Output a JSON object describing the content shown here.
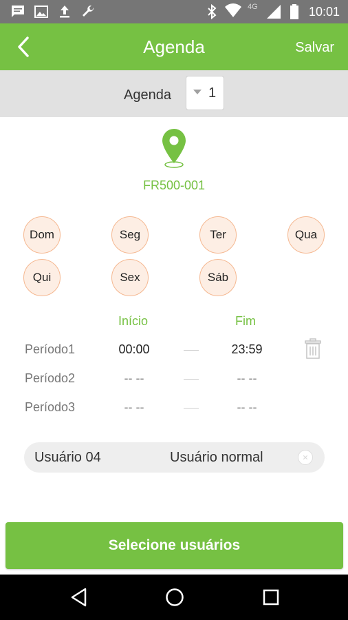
{
  "status_bar": {
    "time": "10:01",
    "network": "4G",
    "icons": [
      "message-icon",
      "image-icon",
      "upload-icon",
      "wrench-icon",
      "bluetooth-icon",
      "wifi-icon",
      "signal-icon",
      "battery-icon"
    ]
  },
  "app_bar": {
    "title": "Agenda",
    "save_label": "Salvar",
    "back_icon": "chevron-left-icon"
  },
  "agenda": {
    "label": "Agenda",
    "selected_value": "1"
  },
  "device": {
    "name": "FR500-001",
    "icon": "location-pin-icon"
  },
  "days": [
    "Dom",
    "Seg",
    "Ter",
    "Qua",
    "Qui",
    "Sex",
    "Sáb"
  ],
  "schedule": {
    "start_header": "Início",
    "end_header": "Fim",
    "periods": [
      {
        "label": "Período1",
        "start": "00:00",
        "end": "23:59"
      },
      {
        "label": "Período2",
        "start": "-- --",
        "end": "-- --"
      },
      {
        "label": "Período3",
        "start": "-- --",
        "end": "-- --"
      }
    ]
  },
  "user": {
    "name": "Usuário 04",
    "type": "Usuário normal"
  },
  "select_users_label": "Selecione usuários",
  "colors": {
    "accent": "#76c143",
    "status_bar": "#767676",
    "agenda_bar": "#e1e1e1",
    "day_fill": "#fdeee4",
    "day_border": "#f5b891"
  }
}
